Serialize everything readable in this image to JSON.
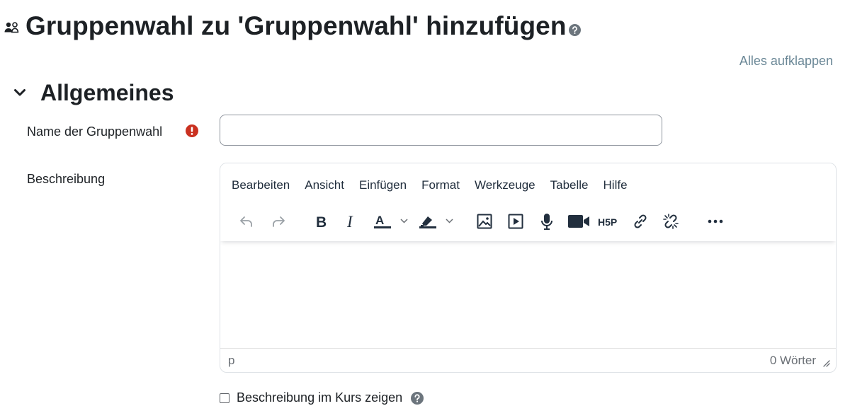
{
  "page": {
    "title": "Gruppenwahl zu 'Gruppenwahl' hinzufügen",
    "icon": "users-icon",
    "help_icon": "question-circle-icon"
  },
  "expand_all_link": "Alles aufklappen",
  "section": {
    "title": "Allgemeines",
    "icon": "chevron-down-icon"
  },
  "form": {
    "name_label": "Name der Gruppenwahl",
    "name_required_icon": "exclamation-circle-icon",
    "name_value": "",
    "description_label": "Beschreibung",
    "show_description_label": "Beschreibung im Kurs zeigen"
  },
  "editor": {
    "menu": [
      "Bearbeiten",
      "Ansicht",
      "Einfügen",
      "Format",
      "Werkzeuge",
      "Tabelle",
      "Hilfe"
    ],
    "toolbar_icons": [
      "undo-icon",
      "redo-icon",
      "bold-icon",
      "italic-icon",
      "text-color-icon",
      "highlight-color-icon",
      "image-icon",
      "media-icon",
      "microphone-icon",
      "video-camera-icon",
      "h5p-icon",
      "link-icon",
      "unlink-icon",
      "more-icon"
    ],
    "h5p_text": "H5P",
    "status_path": "p",
    "word_count": "0 Wörter"
  },
  "colors": {
    "text": "#1d2125",
    "link": "#6a8796",
    "required": "#ca3120",
    "border": "#8f959e"
  }
}
